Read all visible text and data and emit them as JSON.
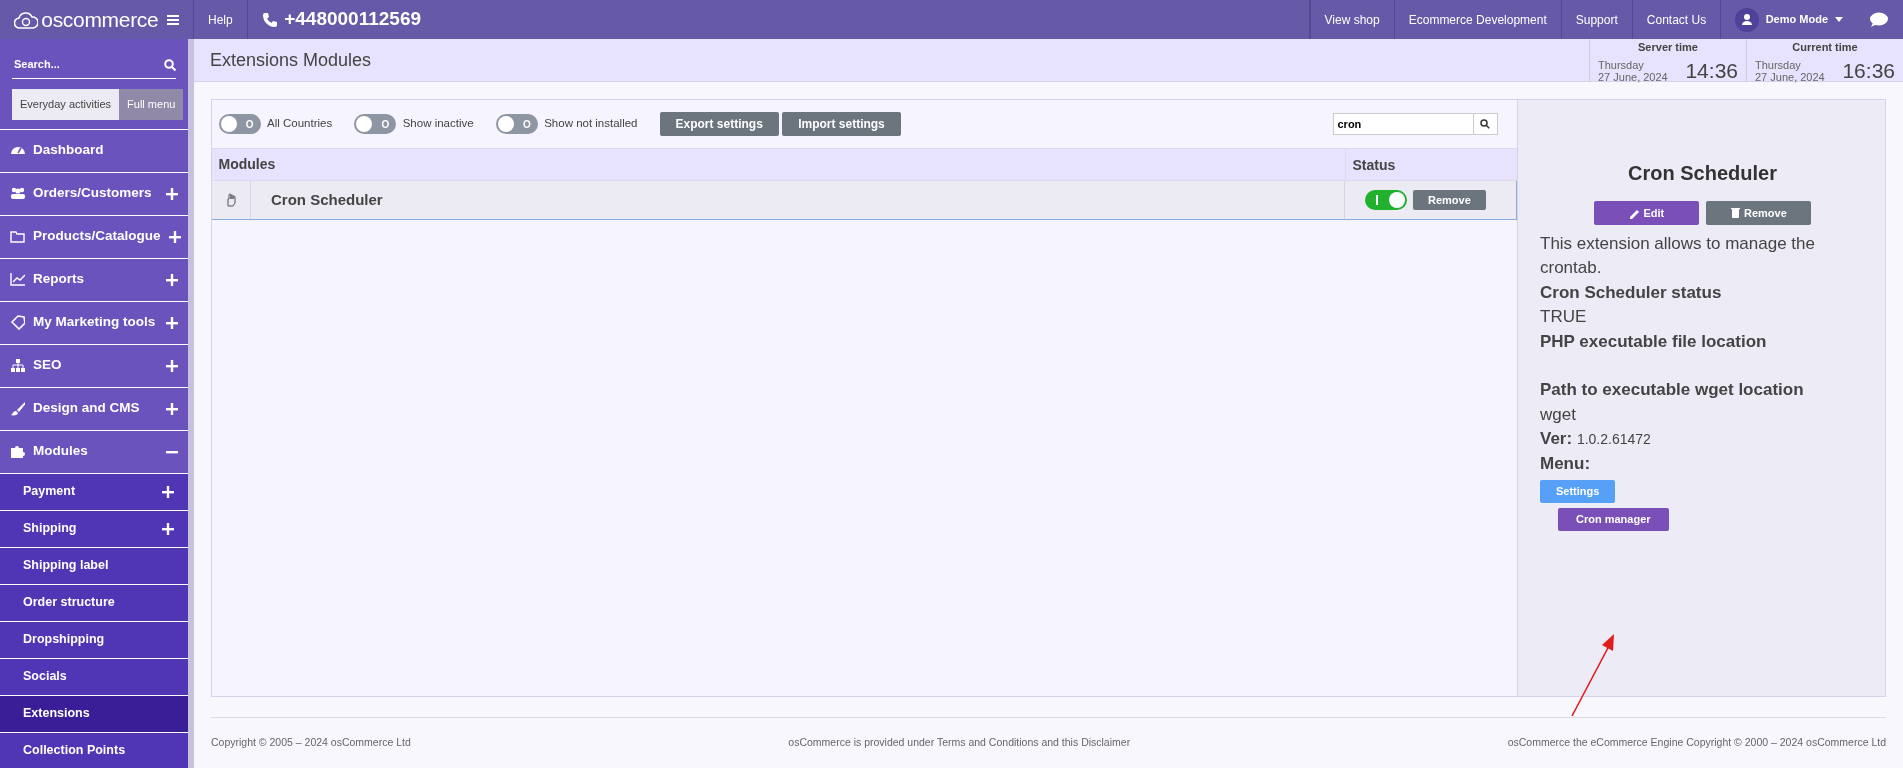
{
  "topbar": {
    "logo": "oscommerce",
    "help": "Help",
    "phone": "+448000112569",
    "links": [
      "View shop",
      "Ecommerce Development",
      "Support",
      "Contact Us"
    ],
    "user": "Demo Mode"
  },
  "sidebar": {
    "search_placeholder": "Search...",
    "tabs": [
      {
        "label": "Everyday activities",
        "selected": false
      },
      {
        "label": "Full menu",
        "selected": true
      }
    ],
    "items": [
      {
        "label": "Dashboard",
        "kind": "link"
      },
      {
        "label": "Orders/Customers",
        "kind": "group",
        "expanded": false
      },
      {
        "label": "Products/Catalogue",
        "kind": "group",
        "expanded": false
      },
      {
        "label": "Reports",
        "kind": "group",
        "expanded": false
      },
      {
        "label": "My Marketing tools",
        "kind": "group",
        "expanded": false
      },
      {
        "label": "SEO",
        "kind": "group",
        "expanded": false
      },
      {
        "label": "Design and CMS",
        "kind": "group",
        "expanded": false
      },
      {
        "label": "Modules",
        "kind": "group",
        "expanded": true,
        "children": [
          {
            "label": "Payment",
            "kind": "group",
            "expanded": false,
            "selected": false
          },
          {
            "label": "Shipping",
            "kind": "group",
            "expanded": false,
            "selected": false
          },
          {
            "label": "Shipping label",
            "kind": "link",
            "selected": false
          },
          {
            "label": "Order structure",
            "kind": "link",
            "selected": false
          },
          {
            "label": "Dropshipping",
            "kind": "link",
            "selected": false
          },
          {
            "label": "Socials",
            "kind": "link",
            "selected": false
          },
          {
            "label": "Extensions",
            "kind": "link",
            "selected": true
          },
          {
            "label": "Collection Points",
            "kind": "link",
            "selected": false
          }
        ]
      }
    ]
  },
  "page_title": "Extensions Modules",
  "clocks": [
    {
      "title": "Server time",
      "day": "Thursday",
      "date": "27 June, 2024",
      "time": "14:36"
    },
    {
      "title": "Current time",
      "day": "Thursday",
      "date": "27 June, 2024",
      "time": "16:36"
    }
  ],
  "filters": [
    {
      "label": "All Countries",
      "on": false,
      "switch_text": "O"
    },
    {
      "label": "Show inactive",
      "on": false,
      "switch_text": "O"
    },
    {
      "label": "Show not installed",
      "on": false,
      "switch_text": "O"
    }
  ],
  "toolbar_buttons": [
    "Export settings",
    "Import settings"
  ],
  "search": {
    "value": "cron"
  },
  "table": {
    "columns": [
      "Modules",
      "Status"
    ],
    "rows": [
      {
        "name": "Cron Scheduler",
        "on": true,
        "action": "Remove",
        "selected": true
      }
    ]
  },
  "details": {
    "title": "Cron Scheduler",
    "buttons": [
      {
        "label": "Edit",
        "kind": "edit"
      },
      {
        "label": "Remove",
        "kind": "remove"
      }
    ],
    "lines": [
      {
        "kind": "text",
        "text": "This extension allows to manage the crontab."
      },
      {
        "kind": "heading",
        "text": "Cron Scheduler status"
      },
      {
        "kind": "text",
        "text": "TRUE"
      },
      {
        "kind": "heading",
        "text": "PHP executable file location"
      },
      {
        "kind": "blank"
      },
      {
        "kind": "heading",
        "text": "Path to executable wget location"
      },
      {
        "kind": "text",
        "text": "wget"
      },
      {
        "kind": "version",
        "label": "Ver:",
        "text": "1.0.2.61472"
      },
      {
        "kind": "heading",
        "text": "Menu:"
      }
    ],
    "menu_buttons": [
      {
        "label": "Settings",
        "kind": "settings"
      },
      {
        "label": "Cron manager",
        "kind": "manager"
      }
    ]
  },
  "footer": {
    "left": "Copyright © 2005 – 2024 ",
    "left_link": "osCommerce Ltd",
    "mid_1": "osCommerce is provided under ",
    "mid_link_1": "Terms and Conditions",
    "mid_2": " and this ",
    "mid_link_2": "Disclaimer",
    "right": "osCommerce the eCommerce Engine Copyright © 2000 – 2024 osCommerce Ltd"
  }
}
